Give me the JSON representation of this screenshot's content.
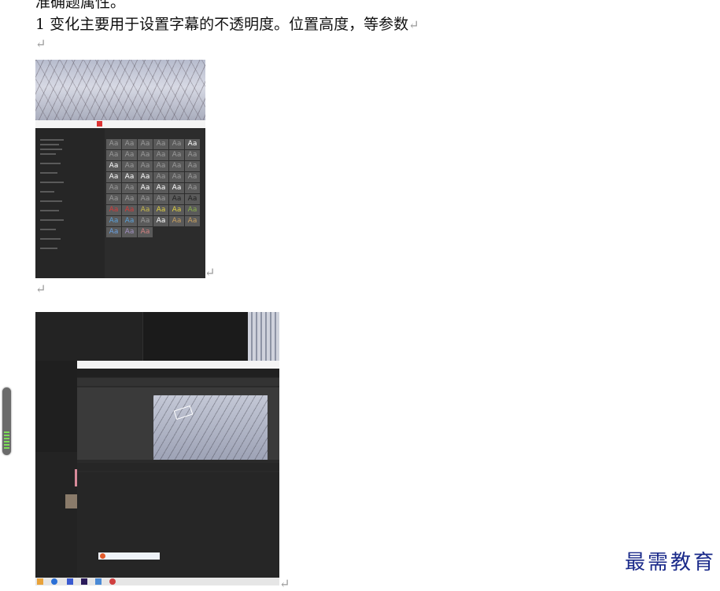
{
  "doc": {
    "cut_off_line": "准确题属性。",
    "paragraph": "1 变化主要用于设置字幕的不透明度。位置高度，等参数",
    "return_mark": "↵"
  },
  "style_grid": {
    "cells": [
      "Aa",
      "Aa",
      "Aa",
      "Aa",
      "Aa",
      "Aa",
      "Aa",
      "Aa",
      "Aa",
      "Aa",
      "Aa",
      "Aa",
      "Aa",
      "Aa",
      "Aa",
      "Aa",
      "Aa",
      "Aa",
      "Aa",
      "Aa",
      "Aa",
      "Aa",
      "Aa",
      "Aa",
      "Aa",
      "Aa",
      "Aa",
      "Aa",
      "Aa",
      "Aa",
      "Aa",
      "Aa",
      "Aa",
      "Aa",
      "Aa",
      "Aa",
      "Aa",
      "Aa",
      "Aa",
      "Aa",
      "Aa",
      "Aa",
      "Aa",
      "Aa",
      "Aa",
      "Aa",
      "Aa",
      "Aa",
      "Aa",
      "Aa",
      "Aa"
    ],
    "colors": [
      "#9a9a9a",
      "#9a9a9a",
      "#9a9a9a",
      "#9a9a9a",
      "#9a9a9a",
      "#ffffff",
      "#9a9a9a",
      "#9a9a9a",
      "#9a9a9a",
      "#9a9a9a",
      "#9a9a9a",
      "#9a9a9a",
      "#ffffff",
      "#9a9a9a",
      "#9a9a9a",
      "#9a9a9a",
      "#9a9a9a",
      "#9a9a9a",
      "#ffffff",
      "#ffffff",
      "#ffffff",
      "#9a9a9a",
      "#9a9a9a",
      "#9a9a9a",
      "#9a9a9a",
      "#9a9a9a",
      "#ffffff",
      "#ffffff",
      "#ffffff",
      "#9a9a9a",
      "#9a9a9a",
      "#9a9a9a",
      "#9a9a9a",
      "#9a9a9a",
      "#222222",
      "#222222",
      "#d23b3b",
      "#d23b3b",
      "#c8b84a",
      "#e0d040",
      "#e0d040",
      "#8ab04a",
      "#5aa0d8",
      "#5aa0d8",
      "#9a9a9a",
      "#ffffff",
      "#c8a060",
      "#c8a060",
      "#6aa0e0",
      "#a090c0",
      "#d08080"
    ]
  },
  "logo": {
    "text": "最需教育"
  },
  "colors": {
    "accent": "#1a2a8a",
    "scroll_ticks": "#7ddf57"
  }
}
